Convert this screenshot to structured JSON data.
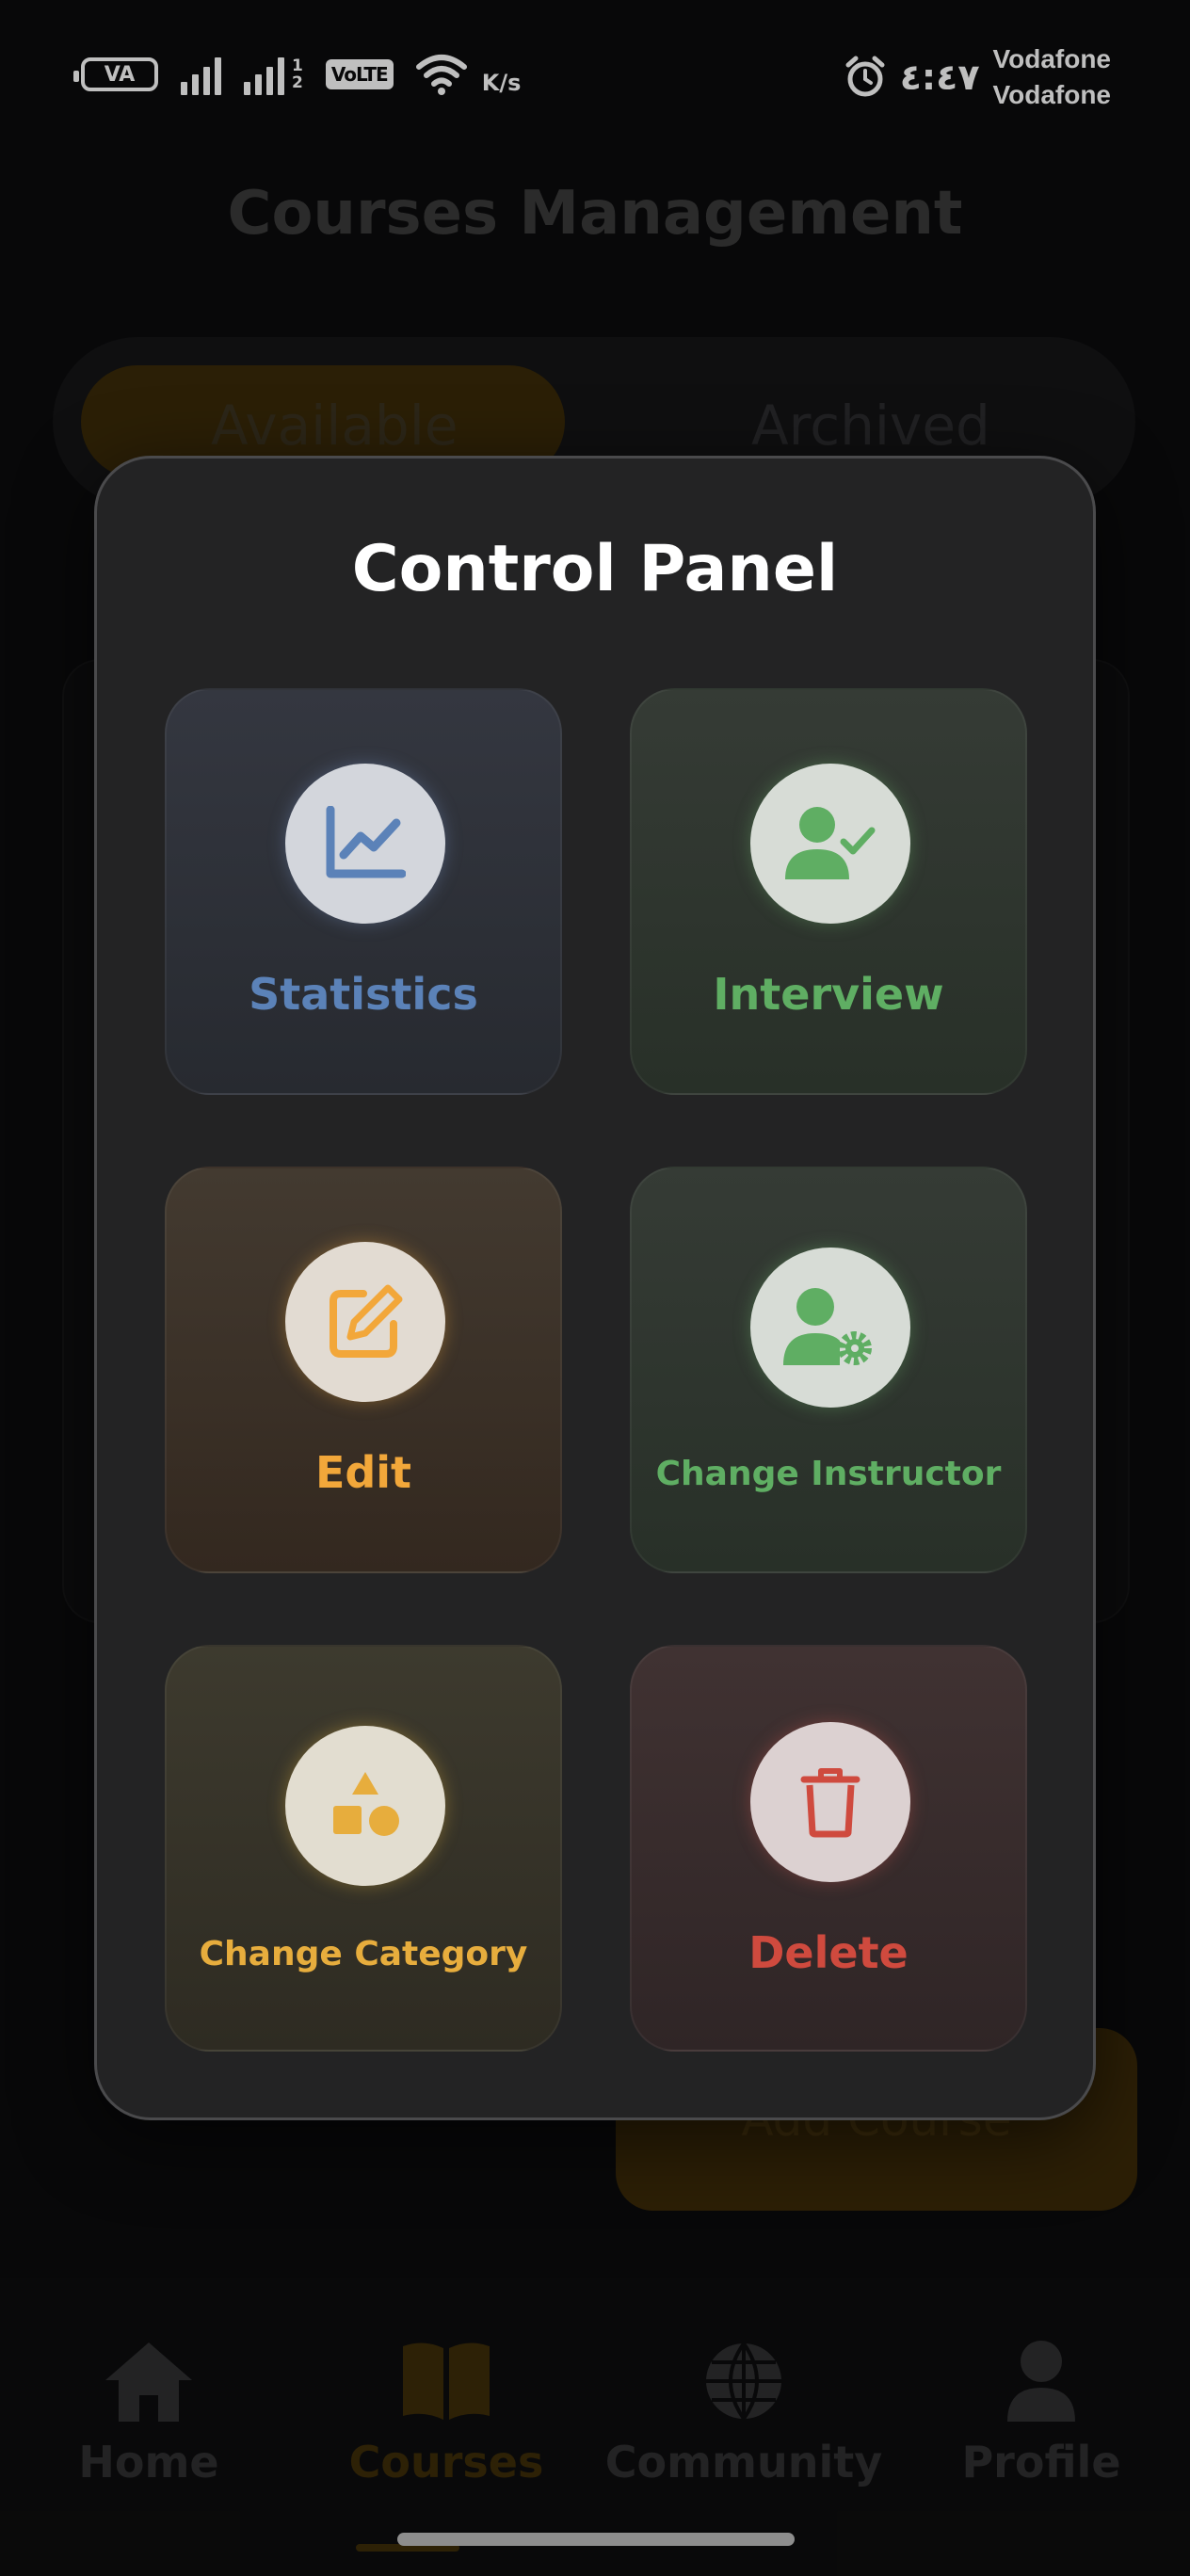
{
  "status_bar": {
    "battery_text": "VA",
    "volte": "VoLTE",
    "sim2_slots": [
      "1",
      "2"
    ],
    "speed_unit": "K/s",
    "time": "٤:٤٧",
    "carriers": [
      "Vodafone",
      "Vodafone"
    ]
  },
  "page": {
    "title": "Courses Management",
    "tabs": [
      "Available",
      "Archived"
    ],
    "fab_label": "Add Course"
  },
  "modal": {
    "title": "Control Panel",
    "tiles": [
      {
        "label": "Statistics",
        "icon": "chart-line-icon",
        "color": "#5b82b8"
      },
      {
        "label": "Interview",
        "icon": "user-check-icon",
        "color": "#5fae63"
      },
      {
        "label": "Edit",
        "icon": "edit-icon",
        "color": "#f2a73a"
      },
      {
        "label": "Change Instructor",
        "icon": "user-gear-icon",
        "color": "#5fae63"
      },
      {
        "label": "Change Category",
        "icon": "shapes-icon",
        "color": "#e7ad3d"
      },
      {
        "label": "Delete",
        "icon": "trash-icon",
        "color": "#cf4a3e"
      }
    ]
  },
  "bottom_nav": {
    "items": [
      {
        "label": "Home",
        "icon": "home-icon"
      },
      {
        "label": "Courses",
        "icon": "book-icon",
        "active": true
      },
      {
        "label": "Community",
        "icon": "globe-icon"
      },
      {
        "label": "Profile",
        "icon": "person-icon"
      }
    ]
  }
}
